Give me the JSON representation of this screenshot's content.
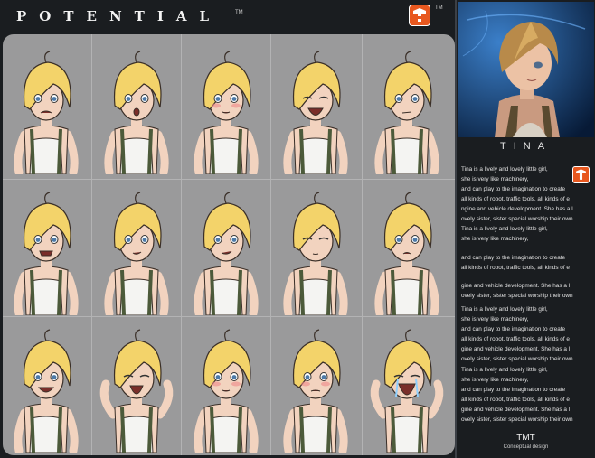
{
  "header": {
    "title": "POTENTIAL",
    "trademark": "TM",
    "logo_trademark": "TM"
  },
  "character": {
    "name": "TINA",
    "bio_paragraph": [
      "Tina is a lively and lovely little girl,",
      "she is very like machinery,",
      "and can play to the imagination to create",
      "all kinds of robot, traffic tools, all kinds of e",
      "ngine and vehicle development. She has a l",
      "ovely sister, sister special worship their own"
    ],
    "bio_short": [
      "Tina is a lively and lovely little girl,",
      "she is very like machinery,"
    ],
    "bio_mid": [
      "and can play to the imagination to create",
      "all kinds of robot, traffic tools, all kinds of e"
    ],
    "bio_tail": [
      "gine and vehicle development. She has a l",
      "ovely sister, sister special worship their own"
    ],
    "bio_block3": [
      "Tina is a lively and lovely little girl,",
      "she is very like machinery,",
      "and can play to the imagination to create",
      "all kinds of robot, traffic tools, all kinds of e",
      "gine and vehicle development. She has a l",
      "ovely sister, sister special worship their own"
    ],
    "bio_block4": [
      "Tina is a lively and lovely little girl,",
      "she is very like machinery,",
      "and can play to the imagination to create",
      "all kinds of robot, traffic tools, all kinds of e",
      "gine and vehicle development. She has a l",
      "ovely sister, sister special worship their own"
    ]
  },
  "credits": {
    "studio": "TMT",
    "subtitle": "Conceptual design"
  },
  "colors": {
    "hair": "#f3d36a",
    "skin": "#f2d3bf",
    "tank": "#f4f4f2",
    "strap": "#4c5a3a",
    "background": "#9a9a9b"
  },
  "expressions": [
    "grumpy",
    "surprised",
    "shy",
    "laughing",
    "annoyed",
    "nervous",
    "sultry",
    "smirking",
    "sleepy",
    "pouting",
    "grinning",
    "yelling",
    "blushing",
    "embarrassed",
    "crying"
  ]
}
